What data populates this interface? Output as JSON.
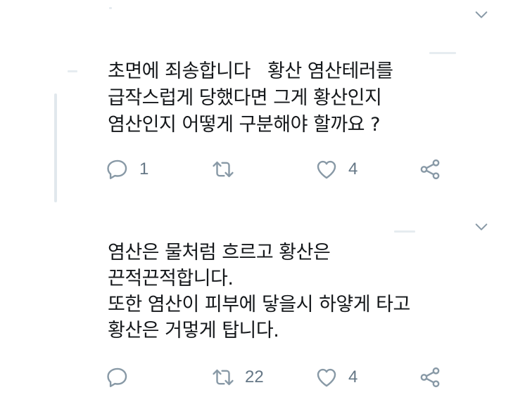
{
  "colors": {
    "text": "#14171a",
    "icon": "#8899a6",
    "count": "#657786",
    "thread_line": "#e1e8ed"
  },
  "tweets": [
    {
      "text": "초면에 죄송합니다   황산 염산테러를\n급작스럽게 당했다면 그게 황산인지\n염산인지 어떻게 구분해야 할까요 ?",
      "actions": {
        "reply": {
          "icon": "reply-icon",
          "count": "1"
        },
        "retweet": {
          "icon": "retweet-icon",
          "count": ""
        },
        "like": {
          "icon": "heart-icon",
          "count": "4"
        },
        "share": {
          "icon": "share-icon"
        }
      },
      "menu_icon": "chevron-down-icon"
    },
    {
      "text": "염산은 물처럼 흐르고 황산은\n끈적끈적합니다.\n또한 염산이 피부에 닿을시 하얗게 타고\n황산은 거멓게 탑니다.",
      "actions": {
        "reply": {
          "icon": "reply-icon",
          "count": ""
        },
        "retweet": {
          "icon": "retweet-icon",
          "count": "22"
        },
        "like": {
          "icon": "heart-icon",
          "count": "4"
        },
        "share": {
          "icon": "share-icon"
        }
      },
      "menu_icon": "chevron-down-icon"
    }
  ]
}
